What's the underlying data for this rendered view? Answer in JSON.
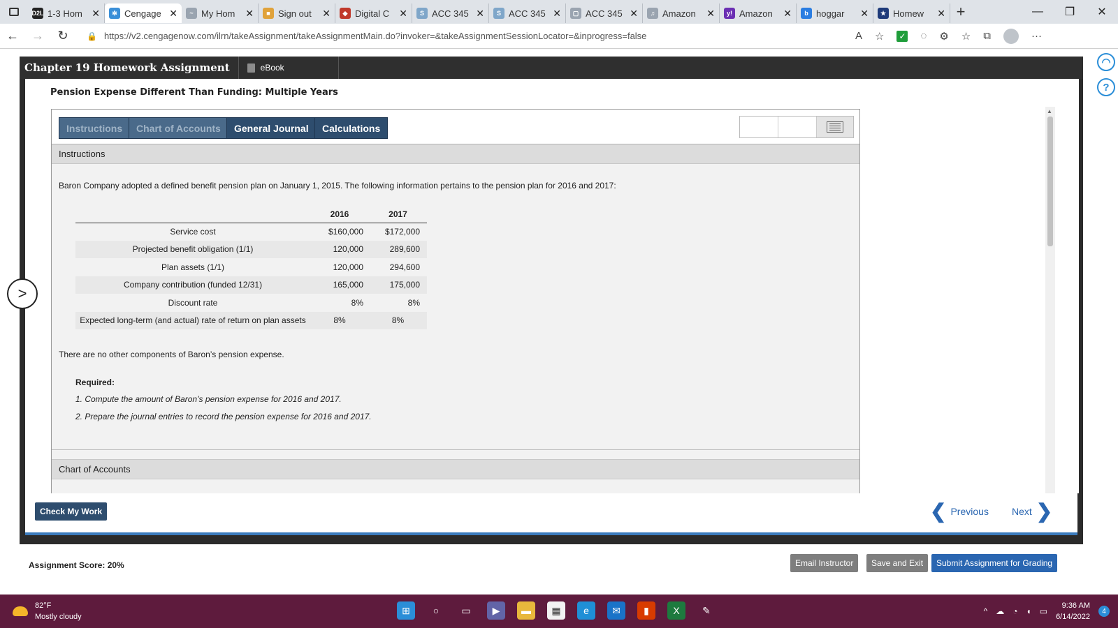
{
  "browser": {
    "tabs": [
      {
        "icon": "D2L",
        "label": "1-3 Hom",
        "color": "#222222"
      },
      {
        "icon": "✻",
        "label": "Cengage",
        "color": "#3a8fd8",
        "active": true
      },
      {
        "icon": "~",
        "label": "My Hom",
        "color": "#9aa4b0"
      },
      {
        "icon": "■",
        "label": "Sign out",
        "color": "#e0a23a"
      },
      {
        "icon": "◆",
        "label": "Digital C",
        "color": "#c0392b"
      },
      {
        "icon": "S",
        "label": "ACC 345",
        "color": "#7fa6c9"
      },
      {
        "icon": "S",
        "label": "ACC 345",
        "color": "#7fa6c9"
      },
      {
        "icon": "▢",
        "label": "ACC 345",
        "color": "#9aa4b0"
      },
      {
        "icon": "♫",
        "label": "Amazon",
        "color": "#9aa4b0"
      },
      {
        "icon": "y!",
        "label": "Amazon",
        "color": "#6b2fb3"
      },
      {
        "icon": "b",
        "label": "hoggar",
        "color": "#2a7de1"
      },
      {
        "icon": "★",
        "label": "Homew",
        "color": "#1f3b7a"
      }
    ],
    "url": "https://v2.cengagenow.com/ilrn/takeAssignment/takeAssignmentMain.do?invoker=&takeAssignmentSessionLocator=&inprogress=false"
  },
  "assignment": {
    "title": "Chapter 19 Homework Assignment",
    "ebook_label": "eBook",
    "problem_title": "Pension Expense Different Than Funding: Multiple Years",
    "tabs": [
      {
        "label": "Instructions",
        "dim": true
      },
      {
        "label": "Chart of Accounts",
        "dim": true
      },
      {
        "label": "General Journal",
        "dim": false
      },
      {
        "label": "Calculations",
        "dim": false
      }
    ],
    "instructions": {
      "heading": "Instructions",
      "intro": "Baron Company adopted a defined benefit pension plan on January 1, 2015. The following information pertains to the pension plan for 2016 and 2017:",
      "table": {
        "headers": [
          "",
          "2016",
          "2017"
        ],
        "rows": [
          [
            "Service cost",
            "$160,000",
            "$172,000"
          ],
          [
            "Projected benefit obligation (1/1)",
            "120,000",
            "289,600"
          ],
          [
            "Plan assets (1/1)",
            "120,000",
            "294,600"
          ],
          [
            "Company contribution (funded 12/31)",
            "165,000",
            "175,000"
          ],
          [
            "Discount rate",
            "8%",
            "8%"
          ],
          [
            "Expected long-term (and actual) rate of return on plan assets",
            "8%",
            "8%"
          ]
        ]
      },
      "note": "There are no other components of Baron’s pension expense.",
      "required_label": "Required:",
      "required": [
        "1. Compute the amount of Baron’s pension expense for 2016 and 2017.",
        "2. Prepare the journal entries to record the pension expense for 2016 and 2017."
      ]
    },
    "chart_heading": "Chart of Accounts",
    "check_button": "Check My Work",
    "previous": "Previous",
    "next": "Next",
    "score": "Assignment Score: 20%",
    "email_button": "Email Instructor",
    "save_button": "Save and Exit",
    "submit_button": "Submit Assignment for Grading"
  },
  "taskbar": {
    "temp": "82°F",
    "weather": "Mostly cloudy",
    "time": "9:36 AM",
    "date": "6/14/2022",
    "notifications": "4"
  }
}
